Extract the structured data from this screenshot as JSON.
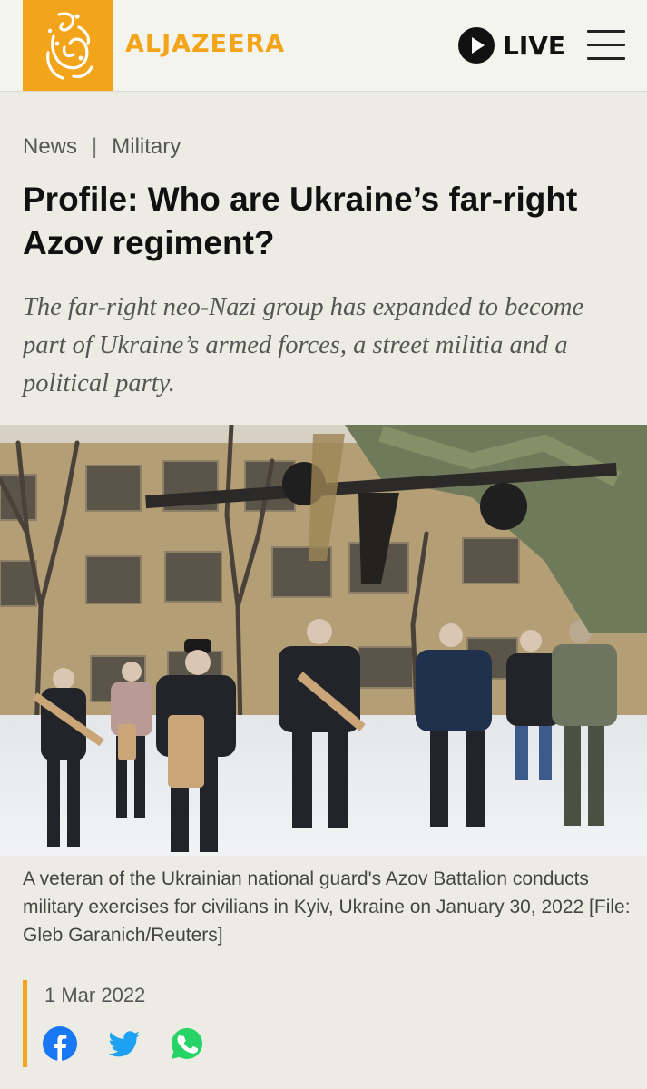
{
  "header": {
    "brand": "ALJAZEERA",
    "live_label": "LIVE",
    "icons": [
      "aljazeera-logo",
      "play-icon",
      "hamburger-menu-icon"
    ]
  },
  "breadcrumb": {
    "section": "News",
    "separator": "|",
    "category": "Military"
  },
  "article": {
    "title": "Profile: Who are Ukraine’s far-right Azov regiment?",
    "subtitle": "The far-right neo-Nazi group has expanded to become part of Ukraine’s armed forces, a street militia and a political party.",
    "caption": "A veteran of the Ukrainian national guard's Azov Battalion conducts military exercises for civilians in Kyiv, Ukraine on January 30, 2022 [File: Gleb Garanich/Reuters]",
    "date": "1 Mar 2022"
  },
  "share": {
    "icons": [
      "facebook-icon",
      "twitter-icon",
      "whatsapp-icon"
    ]
  },
  "colors": {
    "accent": "#f2a51a",
    "background": "#ecece4",
    "facebook": "#1877f2",
    "twitter": "#1da1f2",
    "whatsapp": "#25d366"
  }
}
